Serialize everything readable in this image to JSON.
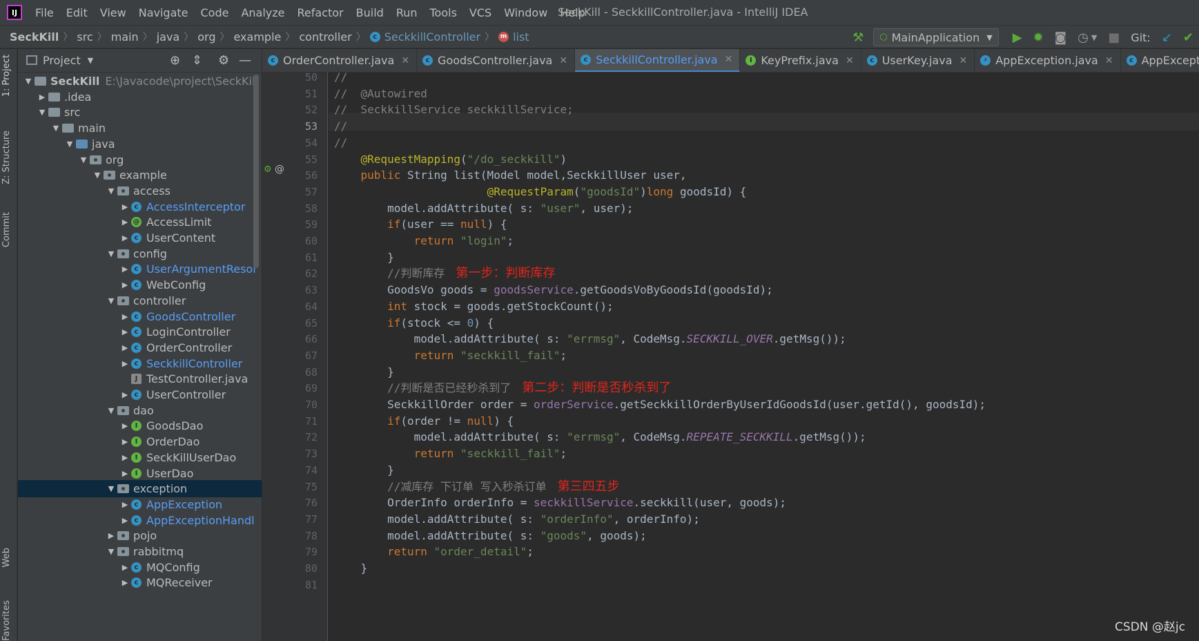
{
  "menubar": {
    "items": [
      "File",
      "Edit",
      "View",
      "Navigate",
      "Code",
      "Analyze",
      "Refactor",
      "Build",
      "Run",
      "Tools",
      "VCS",
      "Window",
      "Help"
    ],
    "window_title": "SeckKill - SeckkillController.java - IntelliJ IDEA"
  },
  "breadcrumb": {
    "items": [
      "SeckKill",
      "src",
      "main",
      "java",
      "org",
      "example",
      "controller",
      "SeckkillController",
      "list"
    ]
  },
  "toolbar": {
    "run_config": "MainApplication",
    "git_label": "Git:"
  },
  "side_tabs": {
    "project": "1: Project",
    "structure": "Z: Structure",
    "commit": "Commit",
    "web": "Web",
    "favorites": "Favorites"
  },
  "project_panel": {
    "title": "Project",
    "root_name": "SeckKill",
    "root_path": "E:\\Javacode\\project\\SeckKill",
    "items": [
      {
        "label": "SeckKill",
        "arrow": "▼",
        "icon": "folder"
      },
      {
        "label": ".idea",
        "arrow": "▶",
        "icon": "folder"
      },
      {
        "label": "src",
        "arrow": "▼",
        "icon": "folder"
      },
      {
        "label": "main",
        "arrow": "▼",
        "icon": "folder"
      },
      {
        "label": "java",
        "arrow": "▼",
        "icon": "folder-src"
      },
      {
        "label": "org",
        "arrow": "▼",
        "icon": "package"
      },
      {
        "label": "example",
        "arrow": "▼",
        "icon": "package"
      },
      {
        "label": "access",
        "arrow": "▼",
        "icon": "package"
      },
      {
        "label": "AccessInterceptor",
        "arrow": "▶",
        "icon": "class",
        "blue": true
      },
      {
        "label": "AccessLimit",
        "arrow": "▶",
        "icon": "annotation"
      },
      {
        "label": "UserContent",
        "arrow": "▶",
        "icon": "class"
      },
      {
        "label": "config",
        "arrow": "▼",
        "icon": "package"
      },
      {
        "label": "UserArgumentResol",
        "arrow": "▶",
        "icon": "class",
        "blue": true
      },
      {
        "label": "WebConfig",
        "arrow": "▶",
        "icon": "class"
      },
      {
        "label": "controller",
        "arrow": "▼",
        "icon": "package"
      },
      {
        "label": "GoodsController",
        "arrow": "▶",
        "icon": "class",
        "blue": true
      },
      {
        "label": "LoginController",
        "arrow": "▶",
        "icon": "class"
      },
      {
        "label": "OrderController",
        "arrow": "▶",
        "icon": "class"
      },
      {
        "label": "SeckkillController",
        "arrow": "▶",
        "icon": "class",
        "blue": true
      },
      {
        "label": "TestController.java",
        "arrow": "",
        "icon": "java-file"
      },
      {
        "label": "UserController",
        "arrow": "▶",
        "icon": "class"
      },
      {
        "label": "dao",
        "arrow": "▼",
        "icon": "package"
      },
      {
        "label": "GoodsDao",
        "arrow": "▶",
        "icon": "interface"
      },
      {
        "label": "OrderDao",
        "arrow": "▶",
        "icon": "interface"
      },
      {
        "label": "SeckKillUserDao",
        "arrow": "▶",
        "icon": "interface"
      },
      {
        "label": "UserDao",
        "arrow": "▶",
        "icon": "interface"
      },
      {
        "label": "exception",
        "arrow": "▼",
        "icon": "package",
        "selected": true
      },
      {
        "label": "AppException",
        "arrow": "▶",
        "icon": "class",
        "blue": true
      },
      {
        "label": "AppExceptionHandl",
        "arrow": "▶",
        "icon": "class",
        "blue": true
      },
      {
        "label": "pojo",
        "arrow": "▶",
        "icon": "package"
      },
      {
        "label": "rabbitmq",
        "arrow": "▼",
        "icon": "package"
      },
      {
        "label": "MQConfig",
        "arrow": "▶",
        "icon": "class"
      },
      {
        "label": "MQReceiver",
        "arrow": "▶",
        "icon": "class"
      }
    ]
  },
  "tabs": [
    {
      "label": "OrderController.java",
      "icon": "c"
    },
    {
      "label": "GoodsController.java",
      "icon": "c"
    },
    {
      "label": "SeckkillController.java",
      "icon": "c",
      "active": true
    },
    {
      "label": "KeyPrefix.java",
      "icon": "i"
    },
    {
      "label": "UserKey.java",
      "icon": "c"
    },
    {
      "label": "AppException.java",
      "icon": "e"
    },
    {
      "label": "AppExceptionHandle",
      "icon": "c"
    }
  ],
  "editor": {
    "current_line": "53",
    "line_numbers": [
      "50",
      "51",
      "52",
      "53",
      "54",
      "55",
      "56",
      "57",
      "58",
      "59",
      "60",
      "61",
      "62",
      "63",
      "64",
      "65",
      "66",
      "67",
      "68",
      "69",
      "70",
      "71",
      "72",
      "73",
      "74",
      "75",
      "76",
      "77",
      "78",
      "79",
      "80",
      "81"
    ],
    "lines": [
      "//",
      "//  @Autowired",
      "//  SeckkillService seckkillService;",
      "//",
      "//",
      "    @RequestMapping(\"/do_seckkill\")",
      "    public String list(Model model,SeckkillUser user,",
      "                       @RequestParam(\"goodsId\")long goodsId) {",
      "        model.addAttribute( s: \"user\", user);",
      "        if(user == null) {",
      "            return \"login\";",
      "        }",
      "        //判断库存",
      "        GoodsVo goods = goodsService.getGoodsVoByGoodsId(goodsId);",
      "        int stock = goods.getStockCount();",
      "        if(stock <= 0) {",
      "            model.addAttribute( s: \"errmsg\", CodeMsg.SECKKILL_OVER.getMsg());",
      "            return \"seckkill_fail\";",
      "        }",
      "        //判断是否已经秒杀到了",
      "        SeckkillOrder order = orderService.getSeckkillOrderByUserIdGoodsId(user.getId(), goodsId);",
      "        if(order != null) {",
      "            model.addAttribute( s: \"errmsg\", CodeMsg.REPEATE_SECKKILL.getMsg());",
      "            return \"seckkill_fail\";",
      "        }",
      "        //减库存 下订单 写入秒杀订单",
      "        OrderInfo orderInfo = seckkillService.seckkill(user, goods);",
      "        model.addAttribute( s: \"orderInfo\", orderInfo);",
      "        model.addAttribute( s: \"goods\", goods);",
      "        return \"order_detail\";",
      "    }",
      ""
    ],
    "annotations": {
      "step1": "第一步：判断库存",
      "step2": "第二步：判断是否秒杀到了",
      "step3": "第三四五步"
    }
  },
  "watermark": "CSDN @赵jc"
}
